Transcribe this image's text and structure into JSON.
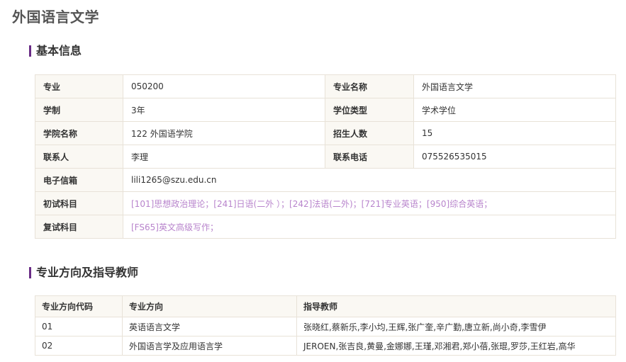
{
  "page": {
    "title": "外国语言文学"
  },
  "basic_info": {
    "heading": "基本信息",
    "rows": [
      {
        "label1": "专业",
        "value1": "050200",
        "label2": "专业名称",
        "value2": "外国语言文学"
      },
      {
        "label1": "学制",
        "value1": "3年",
        "label2": "学位类型",
        "value2": "学术学位"
      },
      {
        "label1": "学院名称",
        "value1": "122 外国语学院",
        "label2": "招生人数",
        "value2": "15"
      },
      {
        "label1": "联系人",
        "value1": "李理",
        "label2": "联系电话",
        "value2": "075526535015"
      }
    ],
    "email_label": "电子信箱",
    "email_value": "lili1265@szu.edu.cn",
    "prelim_label": "初试科目",
    "prelim_value": "[101]思想政治理论；[241]日语(二外 ）；[242]法语(二外)；[721]专业英语；[950]综合英语；",
    "retest_label": "复试科目",
    "retest_value": "[FS65]英文高级写作；"
  },
  "directions": {
    "heading": "专业方向及指导教师",
    "columns": [
      "专业方向代码",
      "专业方向",
      "指导教师"
    ],
    "rows": [
      {
        "code": "01",
        "name": "英语语言文学",
        "advisors": "张晓红,蔡新乐,李小均,王辉,张广奎,辛广勤,唐立新,尚小奇,李雪伊"
      },
      {
        "code": "02",
        "name": "外国语言学及应用语言学",
        "advisors": "JEROEN,张吉良,黄曼,金娜娜,王瑾,邓湘君,郑小蓓,张琨,罗莎,王红岩,高华"
      }
    ]
  },
  "colors": {
    "accent_bar": "#6a2c86",
    "subject_link": "#b884cc",
    "label_bg": "#faf8f3",
    "border": "#e8e2d8"
  }
}
